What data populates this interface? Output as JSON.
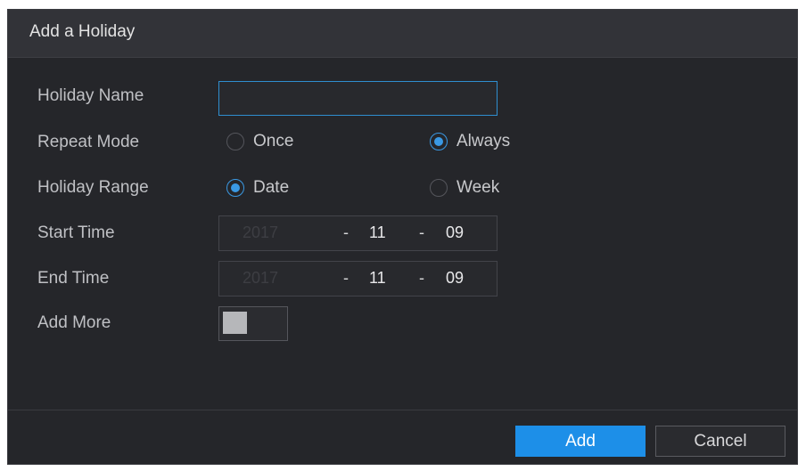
{
  "dialog": {
    "title": "Add a Holiday"
  },
  "form": {
    "holiday_name": {
      "label": "Holiday Name",
      "value": ""
    },
    "repeat_mode": {
      "label": "Repeat Mode",
      "options": [
        {
          "label": "Once",
          "selected": false
        },
        {
          "label": "Always",
          "selected": true
        }
      ]
    },
    "holiday_range": {
      "label": "Holiday Range",
      "options": [
        {
          "label": "Date",
          "selected": true
        },
        {
          "label": "Week",
          "selected": false
        }
      ]
    },
    "start_time": {
      "label": "Start Time",
      "year": "2017",
      "month": "11",
      "day": "09",
      "sep": "-"
    },
    "end_time": {
      "label": "End Time",
      "year": "2017",
      "month": "11",
      "day": "09",
      "sep": "-"
    },
    "add_more": {
      "label": "Add More",
      "enabled": false
    }
  },
  "buttons": {
    "add": "Add",
    "cancel": "Cancel"
  },
  "colors": {
    "accent": "#3a99e4",
    "primary_button": "#1d8fe8",
    "dialog_bg": "#25262a"
  }
}
